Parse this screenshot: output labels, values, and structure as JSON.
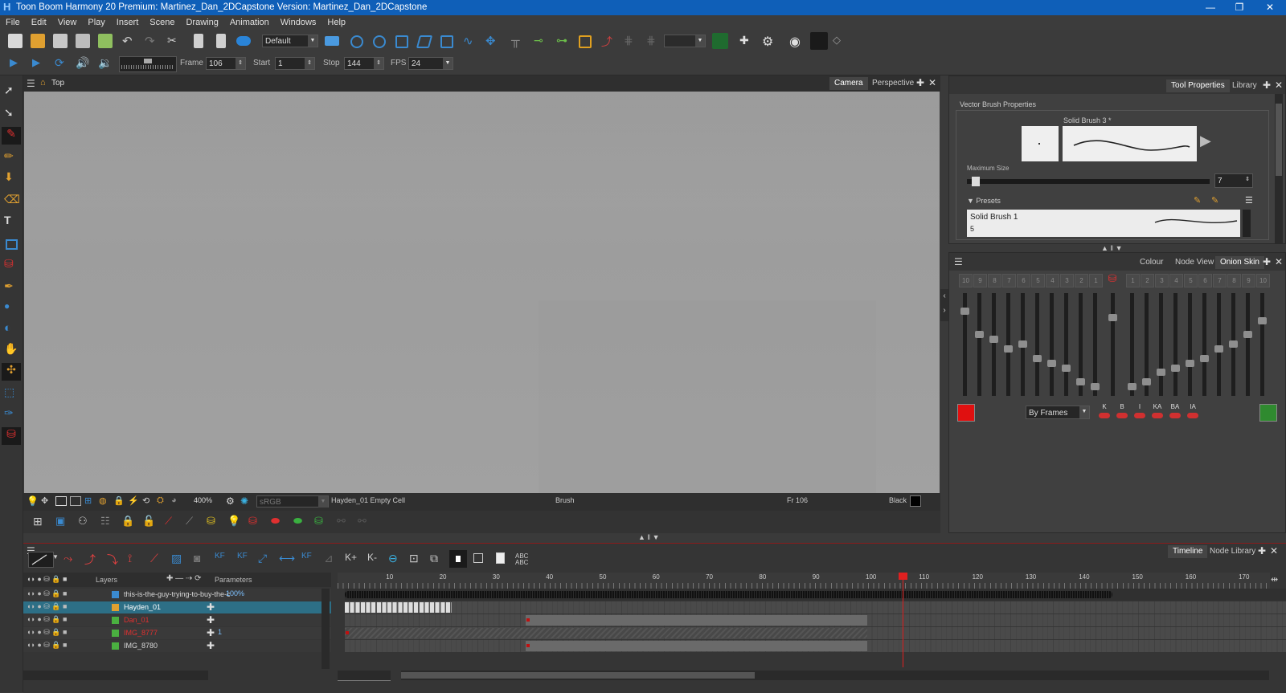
{
  "window": {
    "title": "Toon Boom Harmony 20 Premium: Martinez_Dan_2DCapstone Version: Martinez_Dan_2DCapstone",
    "controls": [
      "—",
      "❐",
      "✕"
    ]
  },
  "menu": [
    "File",
    "Edit",
    "View",
    "Play",
    "Insert",
    "Scene",
    "Drawing",
    "Animation",
    "Windows",
    "Help"
  ],
  "toolbar": {
    "workspace": "Default",
    "frame_label": "Frame",
    "frame_value": "106",
    "start_label": "Start",
    "start_value": "1",
    "stop_label": "Stop",
    "stop_value": "144",
    "fps_label": "FPS",
    "fps_value": "24"
  },
  "viewport": {
    "breadcrumb": "Top",
    "tabs": [
      "Camera",
      "Perspective"
    ],
    "zoom": "400%",
    "colorspace": "sRGB",
    "status_cell": "Hayden_01 Empty Cell",
    "status_tool": "Brush",
    "status_frame": "Fr 106",
    "status_color": "Black"
  },
  "tool_properties": {
    "tabs": [
      "Tool Properties",
      "Library"
    ],
    "section": "Vector Brush Properties",
    "brush_name": "Solid Brush 3 *",
    "max_size_label": "Maximum Size",
    "max_size_value": "7",
    "presets_label": "Presets",
    "preset_name": "Solid Brush 1",
    "preset_size": "5"
  },
  "onion_skin": {
    "tabs": [
      "Colour",
      "Node View",
      "Onion Skin"
    ],
    "mode": "By Frames",
    "buttons": [
      "K",
      "B",
      "I",
      "KA",
      "BA",
      "IA"
    ],
    "prev_color": "#e01010",
    "next_color": "#2f8a2f",
    "prev_frames": [
      "10",
      "9",
      "8",
      "7",
      "6",
      "5",
      "4",
      "3",
      "2",
      "1"
    ],
    "next_frames": [
      "1",
      "2",
      "3",
      "4",
      "5",
      "6",
      "7",
      "8",
      "9",
      "10"
    ],
    "prev_levels": [
      0.85,
      0.6,
      0.55,
      0.45,
      0.5,
      0.35,
      0.3,
      0.25,
      0.1,
      0.05
    ],
    "current_level": 0.78,
    "next_levels": [
      0.05,
      0.1,
      0.2,
      0.25,
      0.3,
      0.35,
      0.45,
      0.5,
      0.6,
      0.75
    ]
  },
  "timeline": {
    "tabs": [
      "Timeline",
      "Node Library"
    ],
    "layers_header": "Layers",
    "parameters_header": "Parameters",
    "ruler": [
      "10",
      "20",
      "30",
      "40",
      "50",
      "60",
      "70",
      "80",
      "90",
      "100",
      "110",
      "120",
      "130",
      "140",
      "150",
      "160",
      "170"
    ],
    "current_frame": 106,
    "layers": [
      {
        "name": "this-is-the-guy-trying-to-buy-the-c",
        "param": "100%",
        "color": "#d8d8d8",
        "selected": false
      },
      {
        "name": "Hayden_01",
        "param": "",
        "color": "#ffffff",
        "selected": true
      },
      {
        "name": "Dan_01",
        "param": "",
        "color": "#e03030",
        "selected": false
      },
      {
        "name": "IMG_8777",
        "param": "1",
        "color": "#e03030",
        "selected": false
      },
      {
        "name": "IMG_8780",
        "param": "",
        "color": "#d8d8d8",
        "selected": false
      }
    ]
  }
}
